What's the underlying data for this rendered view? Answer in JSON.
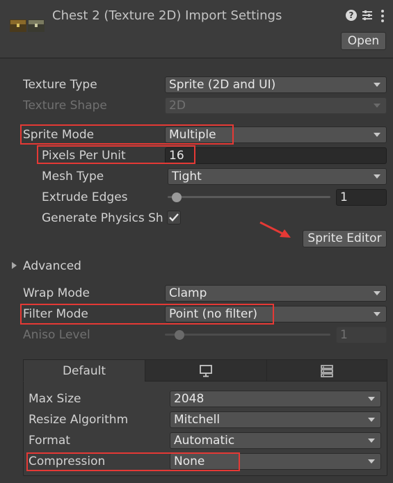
{
  "header": {
    "title": "Chest 2 (Texture 2D) Import Settings",
    "open_button": "Open",
    "icons": [
      "help-icon",
      "presets-icon",
      "more-icon"
    ]
  },
  "texture": {
    "texture_type": {
      "label": "Texture Type",
      "value": "Sprite (2D and UI)"
    },
    "texture_shape": {
      "label": "Texture Shape",
      "value": "2D"
    },
    "sprite_mode": {
      "label": "Sprite Mode",
      "value": "Multiple"
    },
    "pixels_per_unit": {
      "label": "Pixels Per Unit",
      "value": "16"
    },
    "mesh_type": {
      "label": "Mesh Type",
      "value": "Tight"
    },
    "extrude_edges": {
      "label": "Extrude Edges",
      "value": "1",
      "slider_fraction": 0.04
    },
    "generate_physics": {
      "label": "Generate Physics Sh",
      "checked": true
    },
    "sprite_editor_button": "Sprite Editor"
  },
  "advanced": {
    "label": "Advanced"
  },
  "wrap_mode": {
    "label": "Wrap Mode",
    "value": "Clamp"
  },
  "filter_mode": {
    "label": "Filter Mode",
    "value": "Point (no filter)"
  },
  "aniso_level": {
    "label": "Aniso Level",
    "value": "1",
    "slider_fraction": 0.0
  },
  "platform_tabs": {
    "default_label": "Default",
    "icons": [
      "monitor-icon",
      "server-icon"
    ]
  },
  "platform": {
    "max_size": {
      "label": "Max Size",
      "value": "2048"
    },
    "resize_algorithm": {
      "label": "Resize Algorithm",
      "value": "Mitchell"
    },
    "format": {
      "label": "Format",
      "value": "Automatic"
    },
    "compression": {
      "label": "Compression",
      "value": "None"
    }
  },
  "colors": {
    "highlight": "#e53935",
    "panel": "#383838",
    "field": "#515151"
  }
}
